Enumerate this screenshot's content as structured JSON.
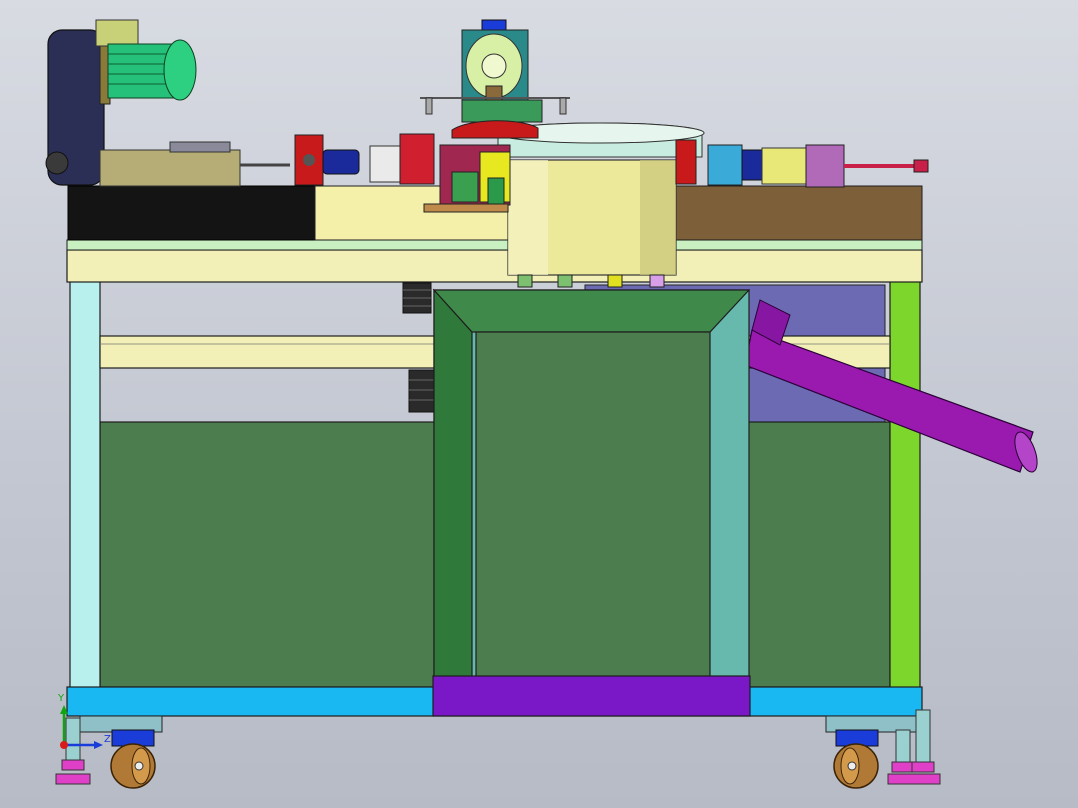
{
  "viewport": {
    "background_top": "#d8dbe2",
    "background_bottom": "#b7bbc6"
  },
  "triad": {
    "y_label": "Y",
    "z_label": "Z",
    "x_color": "#d81b1b",
    "y_color": "#12a312",
    "z_color": "#1a3cd8"
  },
  "colors": {
    "frame_light_yellow": "#f2f0b6",
    "frame_cyan": "#b8f0ee",
    "frame_lime": "#7cd62c",
    "base_blue": "#19b8f2",
    "cabinet_green": "#4b7d4e",
    "stand_green": "#2f7a3a",
    "stand_teal": "#66b9ac",
    "stand_purple": "#7a18c8",
    "tube_purple": "#9a1ab0",
    "table_black": "#141414",
    "table_brown": "#7d5f3a",
    "motor_green": "#25c07a",
    "drum_yellow": "#ecea9a",
    "caster_brown": "#b07a36",
    "leveler_pink": "#e040c8"
  }
}
